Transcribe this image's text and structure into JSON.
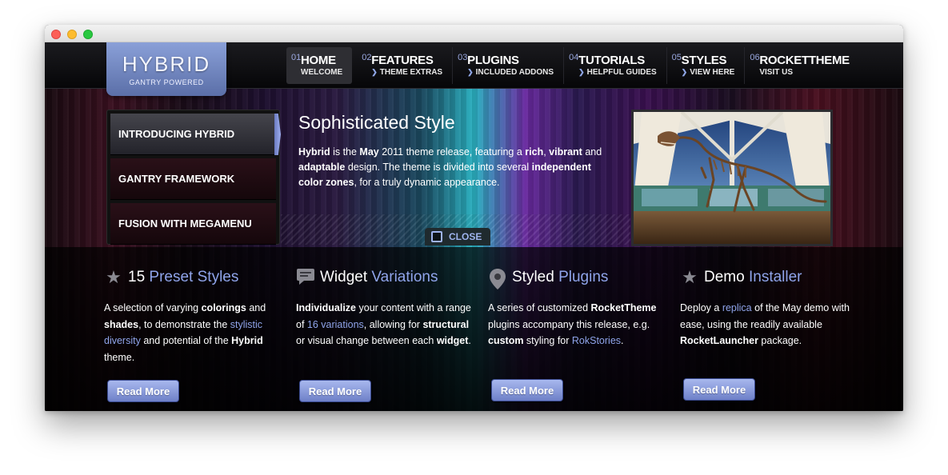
{
  "nav": [
    {
      "num": "01",
      "label": "HOME",
      "sub": "WELCOME",
      "active": true
    },
    {
      "num": "02",
      "label": "FEATURES",
      "sub": "THEME EXTRAS"
    },
    {
      "num": "03",
      "label": "PLUGINS",
      "sub": "INCLUDED ADDONS"
    },
    {
      "num": "04",
      "label": "TUTORIALS",
      "sub": "HELPFUL GUIDES"
    },
    {
      "num": "05",
      "label": "STYLES",
      "sub": "VIEW HERE"
    },
    {
      "num": "06",
      "label": "ROCKETTHEME",
      "sub": "VISIT US"
    }
  ],
  "logo": {
    "title": "HYBRID",
    "subtitle": "GANTRY POWERED"
  },
  "tabs": [
    "INTRODUCING HYBRID",
    "GANTRY FRAMEWORK",
    "FUSION WITH MEGAMENU"
  ],
  "feature": {
    "title": "Sophisticated Style",
    "b1": "Hybrid",
    "t1": " is the ",
    "b2": "May",
    "t2": " 2011 theme release, featuring a ",
    "b3": "rich",
    "t3": ", ",
    "b4": "vibrant",
    "t4": " and ",
    "b5": "adaptable",
    "t5": " design. The theme is divided into several ",
    "b6": "independent color zones",
    "t6": ", for a truly dynamic appearance."
  },
  "close_label": "CLOSE",
  "columns": [
    {
      "icon": "star-icon",
      "title_a": "15 ",
      "title_b": "Preset Styles",
      "body": [
        [
          "t",
          "A selection of varying "
        ],
        [
          "b",
          "colorings"
        ],
        [
          "t",
          " and "
        ],
        [
          "b",
          "shades"
        ],
        [
          "t",
          ", to demonstrate the "
        ],
        [
          "l",
          "stylistic diversity"
        ],
        [
          "t",
          " and potential of the "
        ],
        [
          "b",
          "Hybrid"
        ],
        [
          "t",
          " theme."
        ]
      ],
      "button": "Read More"
    },
    {
      "icon": "chat-icon",
      "title_a": "Widget ",
      "title_b": "Variations",
      "body": [
        [
          "b",
          "Individualize"
        ],
        [
          "t",
          " your content with a range of "
        ],
        [
          "l",
          "16 variations"
        ],
        [
          "t",
          ", allowing for "
        ],
        [
          "b",
          "structural"
        ],
        [
          "t",
          " or visual change between each "
        ],
        [
          "b",
          "widget"
        ],
        [
          "t",
          "."
        ]
      ],
      "button": "Read More"
    },
    {
      "icon": "map-pin-icon",
      "title_a": "Styled ",
      "title_b": "Plugins",
      "body": [
        [
          "t",
          "A series of customized "
        ],
        [
          "b",
          "RocketTheme"
        ],
        [
          "t",
          " plugins accompany this release, e.g. "
        ],
        [
          "b",
          "custom"
        ],
        [
          "t",
          " styling for "
        ],
        [
          "l",
          "RokStories"
        ],
        [
          "t",
          "."
        ]
      ],
      "button": "Read More"
    },
    {
      "icon": "star-icon",
      "title_a": "Demo ",
      "title_b": "Installer",
      "body": [
        [
          "t",
          "Deploy a "
        ],
        [
          "l",
          "replica"
        ],
        [
          "t",
          " of the May demo with ease, using the readily available "
        ],
        [
          "b",
          "RocketLauncher"
        ],
        [
          "t",
          " package."
        ]
      ],
      "button": "Read More"
    }
  ],
  "colors": {
    "accent": "#8fa4ea",
    "button": "#8a9ce0",
    "logo": "#7488c4"
  }
}
